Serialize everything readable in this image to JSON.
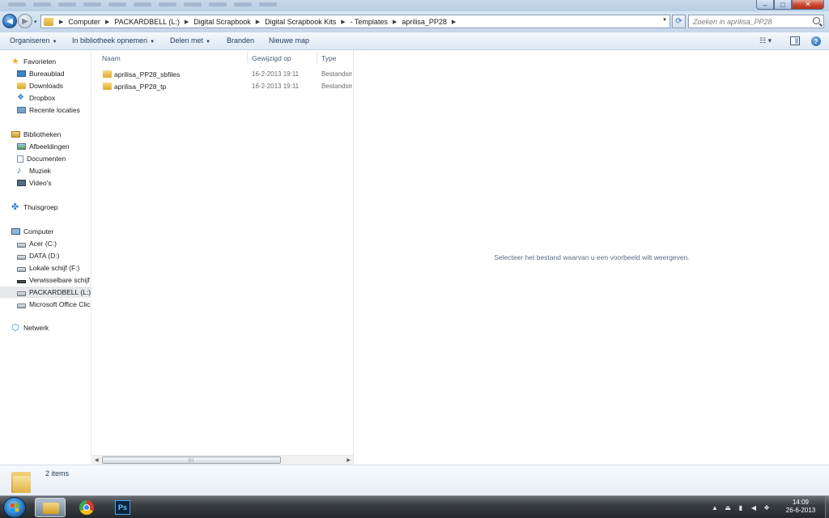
{
  "address_bar": {
    "breadcrumbs": [
      "Computer",
      "PACKARDBELL (L:)",
      "Digital Scrapbook",
      "Digital Scrapbook Kits",
      "- Templates",
      "aprilisa_PP28"
    ],
    "search_placeholder": "Zoeken in aprilisa_PP28"
  },
  "toolbar": {
    "organize": "Organiseren",
    "include_in_library": "In bibliotheek opnemen",
    "share_with": "Delen met",
    "burn": "Branden",
    "new_folder": "Nieuwe map"
  },
  "nav_pane": {
    "favorites": {
      "label": "Favorieten",
      "items": [
        "Bureaublad",
        "Downloads",
        "Dropbox",
        "Recente locaties"
      ]
    },
    "libraries": {
      "label": "Bibliotheken",
      "items": [
        "Afbeeldingen",
        "Documenten",
        "Muziek",
        "Video's"
      ]
    },
    "homegroup": "Thuisgroep",
    "computer": {
      "label": "Computer",
      "items": [
        "Acer (C:)",
        "DATA (D:)",
        "Lokale schijf (F:)",
        "Verwisselbare schijf",
        "PACKARDBELL (L:)",
        "Microsoft Office Clic"
      ],
      "selected": "PACKARDBELL (L:)"
    },
    "network": "Netwerk"
  },
  "file_list": {
    "columns": [
      "Naam",
      "Gewijzigd op",
      "Type"
    ],
    "rows": [
      {
        "name": "aprilisa_PP28_sbfiles",
        "modified": "16-2-2013 19:11",
        "type": "Bestandsmap"
      },
      {
        "name": "aprilisa_PP28_tp",
        "modified": "16-2-2013 19:11",
        "type": "Bestandsmap"
      }
    ]
  },
  "preview": {
    "message": "Selecteer het bestand waarvan u een voorbeeld wilt weergeven."
  },
  "details": {
    "item_count": "2 items"
  },
  "taskbar": {
    "time": "14:09",
    "date": "26-6-2013",
    "photoshop_label": "Ps"
  },
  "colors": {
    "accent": "#1e395b",
    "folder": "#dcab31",
    "close_button": "#c7432a"
  }
}
